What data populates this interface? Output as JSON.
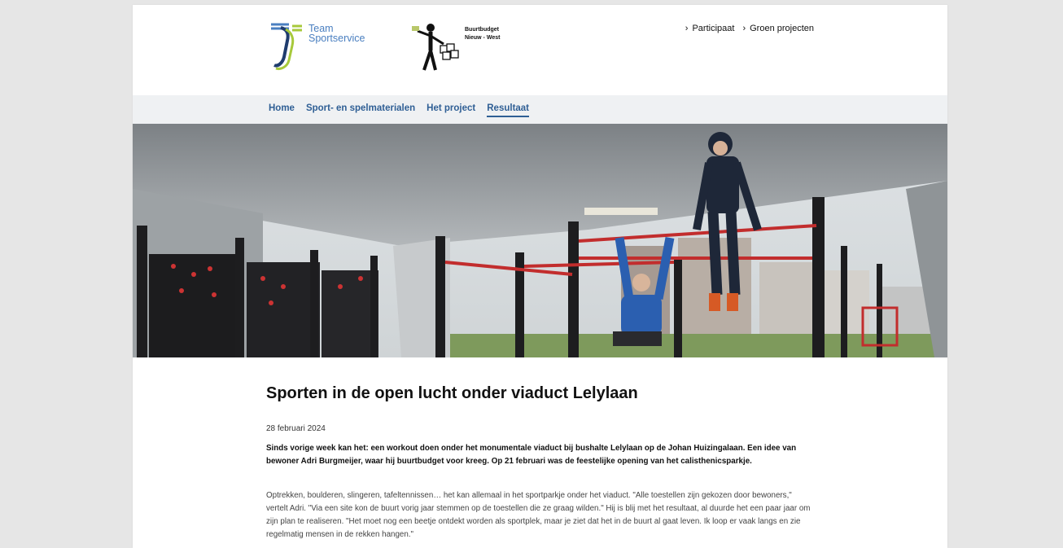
{
  "header": {
    "logo_team_line1": "Team",
    "logo_team_line2": "Sportservice",
    "logo_buurt_line1": "Buurtbudget",
    "logo_buurt_line2": "Nieuw - West",
    "links": [
      {
        "label": "Participaat",
        "icon": "chevron-right-icon"
      },
      {
        "label": "Groen projecten",
        "icon": "chevron-right-icon"
      }
    ]
  },
  "nav": {
    "items": [
      {
        "label": "Home"
      },
      {
        "label": "Sport- en spelmaterialen"
      },
      {
        "label": "Het project"
      },
      {
        "label": "Resultaat"
      }
    ],
    "active_index": 3
  },
  "hero": {
    "kind": "photo",
    "subject": "calisthenics park under a concrete viaduct"
  },
  "article": {
    "title": "Sporten in de open lucht onder viaduct Lelylaan",
    "date": "28 februari 2024",
    "lead": "Sinds vorige week kan het: een workout doen onder het monumentale viaduct bij bushalte Lelylaan op de Johan Huizingalaan. Een idee van bewoner Adri Burgmeijer, waar hij buurtbudget voor kreeg. Op 21 februari was de feestelijke opening van het calisthenicsparkje.",
    "body": "Optrekken, boulderen, slingeren, tafeltennissen… het kan allemaal in het sportparkje onder het viaduct. \"Alle toestellen zijn gekozen door bewoners,\" vertelt Adri. \"Via een site kon de buurt vorig jaar stemmen op de toestellen die ze graag wilden.\" Hij is blij met het resultaat, al duurde het een paar jaar om zijn plan te realiseren. \"Het moet nog een beetje ontdekt worden als sportplek, maar je ziet dat het in de buurt al gaat leven. Ik loop er vaak langs en zie regelmatig mensen in de rekken hangen.\""
  },
  "colors": {
    "nav_text": "#2f5f95",
    "logo_blue": "#4a7fc0",
    "logo_green": "#a7c93b",
    "page_bg": "#e6e6e6"
  }
}
